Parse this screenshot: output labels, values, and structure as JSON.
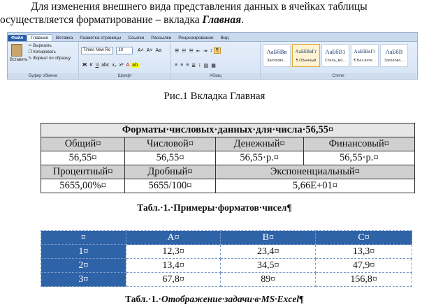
{
  "paragraph": {
    "line1": "Для изменения внешнего вида представления данных в ячейках таблицы",
    "line2_prefix": "осуществляется форматирование – вкладка ",
    "line2_bold": "Главная",
    "line2_suffix": "."
  },
  "ribbon": {
    "tabs": [
      "Файл",
      "Главная",
      "Вставка",
      "Разметка страницы",
      "Ссылки",
      "Рассылки",
      "Рецензирование",
      "Вид"
    ],
    "active_tab": "Главная",
    "clipboard": {
      "paste": "Вставить",
      "cut": "Вырезать",
      "copy": "Копировать",
      "format_painter": "Формат по образцу",
      "label": "Буфер обмена"
    },
    "font": {
      "name": "Times New Ro",
      "size": "10",
      "label": "Шрифт"
    },
    "paragraph_label": "Абзац",
    "styles": [
      {
        "sample": "AaБбВв",
        "name": "Заголово..."
      },
      {
        "sample": "AaБбВвГг",
        "name": "¶ Обычный"
      },
      {
        "sample": "AaБбВ1",
        "name": "Стиль_мо..."
      },
      {
        "sample": "AaБбВвГг",
        "name": "¶ Без инте..."
      },
      {
        "sample": "AaБбВ",
        "name": "Заголово..."
      }
    ],
    "styles_label": "Стили"
  },
  "figure_caption": "Рис.1 Вкладка Главная",
  "table1": {
    "title": "Форматы·числовых·данных·для·числа·56,55¤",
    "row1": [
      "Общий¤",
      "Числовой¤",
      "Денежный¤",
      "Финансовый¤"
    ],
    "row2": [
      "56,55¤",
      "56,55¤",
      "56,55·р.¤",
      "56,55·р.¤"
    ],
    "row3": [
      "Процентный¤",
      "Дробный¤",
      "Экспоненциальный¤"
    ],
    "row4": [
      "5655,00%¤",
      "5655/100¤",
      "5,66E+01¤"
    ]
  },
  "table1_caption": "Табл.·1.·Примеры·форматов·чисел¶",
  "table2": {
    "header": [
      "¤",
      "A¤",
      "B¤",
      "C¤"
    ],
    "rows": [
      [
        "1¤",
        "12,3¤",
        "23,4¤",
        "13,3¤"
      ],
      [
        "2¤",
        "13,4¤",
        "34,5¤",
        "47,9¤"
      ],
      [
        "3¤",
        "67,8¤",
        "89¤",
        "156,8¤"
      ]
    ]
  },
  "table2_caption_prefix": "Табл.·1.·",
  "table2_caption_italic": "Отображение·задачи·в·MS·Excel¶"
}
